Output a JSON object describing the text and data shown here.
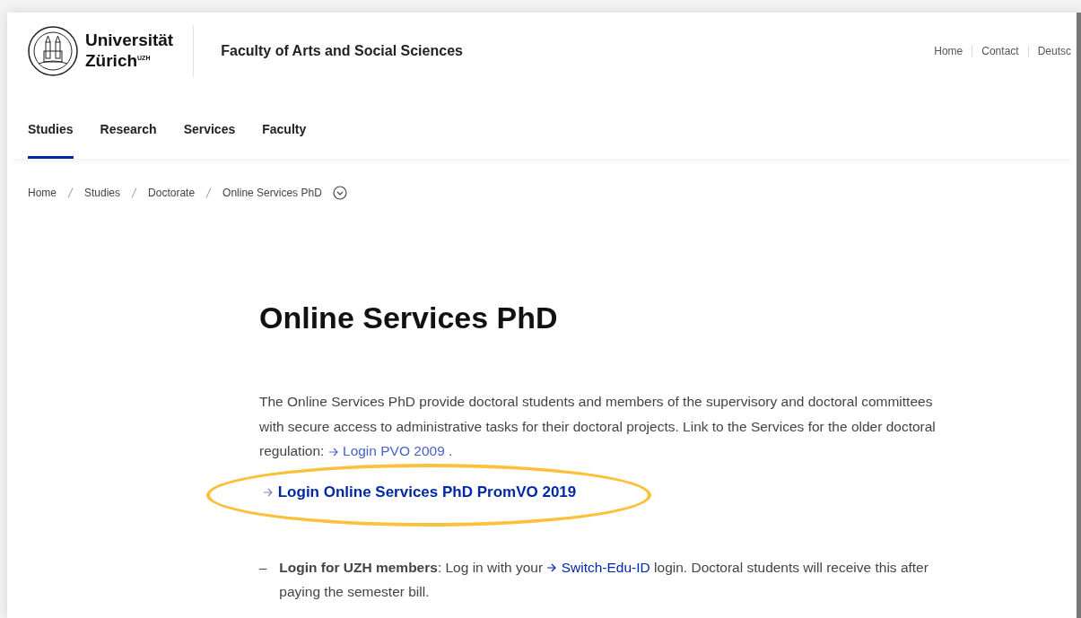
{
  "header": {
    "logo": {
      "line1": "Universität",
      "line2": "Zürich",
      "sup": "UZH"
    },
    "faculty": "Faculty of Arts and Social Sciences",
    "meta_links": [
      "Home",
      "Contact",
      "Deutsc"
    ]
  },
  "nav": [
    {
      "label": "Studies",
      "selected": true
    },
    {
      "label": "Research",
      "selected": false
    },
    {
      "label": "Services",
      "selected": false
    },
    {
      "label": "Faculty",
      "selected": false
    }
  ],
  "breadcrumb": [
    "Home",
    "Studies",
    "Doctorate",
    "Online Services PhD"
  ],
  "title": "Online Services PhD",
  "intro": {
    "before": "The Online Services PhD provide doctoral students and members of the supervisory and doctoral committees with secure access to administrative tasks for their doctoral projects. Link to the Services for the older doctoral regulation:",
    "link": "Login PVO 2009",
    "after": "."
  },
  "main_link": {
    "label": "Login Online Services PhD PromVO 2019",
    "highlighted": true
  },
  "list": [
    {
      "marker": "–",
      "before": "**Login for UZH members**: Log in with your",
      "link": "Switch-Edu-ID",
      "after": "login. Doctoral students will receive this after paying the semester bill."
    }
  ]
}
